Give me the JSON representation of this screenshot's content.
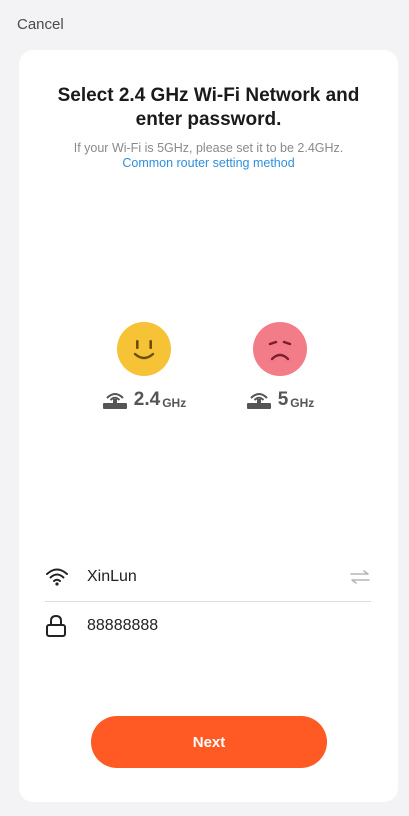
{
  "header": {
    "cancel_label": "Cancel"
  },
  "content": {
    "title_line1": "Select 2.4 GHz Wi-Fi Network and",
    "title_line2": "enter password.",
    "subtitle": "If your Wi-Fi is 5GHz, please set it to be 2.4GHz.",
    "help_link": "Common router setting method"
  },
  "bands": [
    {
      "number": "2.4",
      "unit": "GHz",
      "face": "happy-face-icon",
      "color": "#f6c236"
    },
    {
      "number": "5",
      "unit": "GHz",
      "face": "sad-face-icon",
      "color": "#f27c88"
    }
  ],
  "form": {
    "wifi_name": "XinLun",
    "password": "88888888"
  },
  "actions": {
    "next_label": "Next",
    "accent": "#ff5a24"
  }
}
